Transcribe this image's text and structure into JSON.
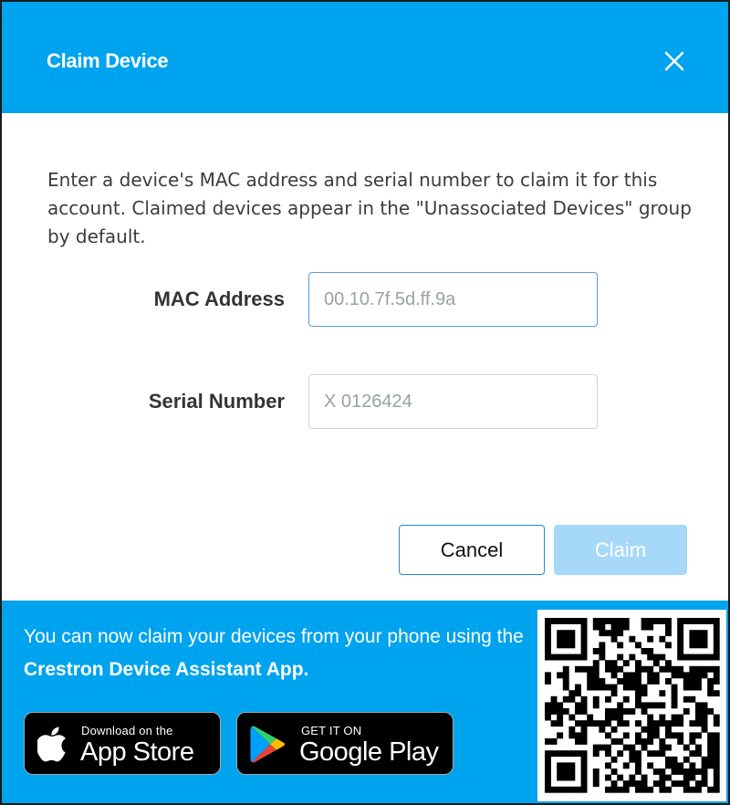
{
  "dialog": {
    "title": "Claim Device",
    "close_label": "Close"
  },
  "intro": "Enter a device's MAC address and serial number to claim it for this account. Claimed devices appear in the \"Unassociated Devices\" group by default.",
  "form": {
    "mac_label": "MAC Address",
    "mac_value": "",
    "mac_placeholder": "00.10.7f.5d.ff.9a",
    "serial_label": "Serial Number",
    "serial_value": "",
    "serial_placeholder": "X 0126424"
  },
  "buttons": {
    "cancel": "Cancel",
    "claim": "Claim"
  },
  "footer": {
    "promo_prefix": "You can now claim your devices from your phone using the ",
    "promo_app_name": "Crestron Device Assistant App.",
    "app_store": {
      "small": "Download on the",
      "big": "App Store"
    },
    "google_play": {
      "small": "GET IT ON",
      "big": "Google Play"
    }
  },
  "colors": {
    "accent": "#00a3ee",
    "claim_disabled": "#a6d9f7",
    "cancel_border": "#1f8bd6"
  }
}
